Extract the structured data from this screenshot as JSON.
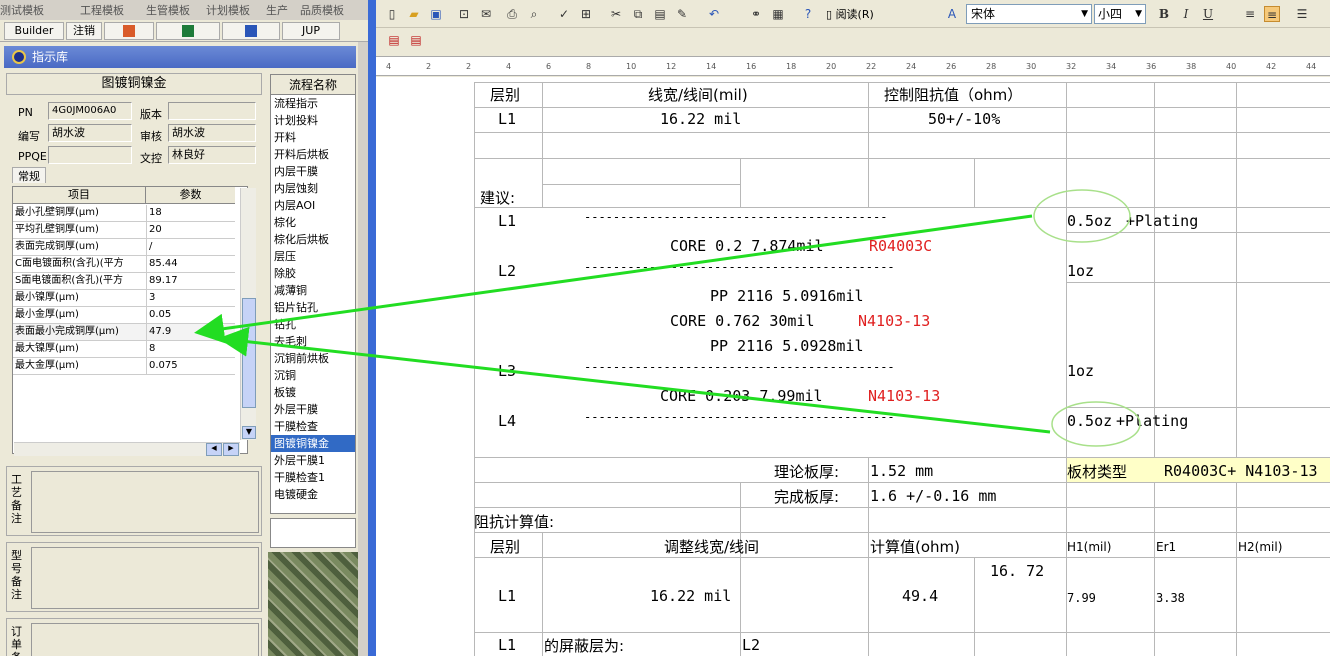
{
  "left": {
    "top_tabs": [
      "测试模板",
      "工程模板",
      "生管模板",
      "计划模板",
      "生产",
      "品质模板"
    ],
    "toolbar": {
      "builder": "Builder",
      "cancel": "注销",
      "jup": "JUP"
    },
    "panel_title": "指示库",
    "form_title": "图镀铜镍金",
    "fields": {
      "pn_label": "PN",
      "pn_value": "4G0JM006A0",
      "version_label": "版本",
      "version_value": "",
      "writer_label": "编写",
      "writer_value": "胡水波",
      "reviewer_label": "审核",
      "reviewer_value": "胡水波",
      "ppqe_label": "PPQE",
      "ppqe_value": "",
      "doc_label": "文控",
      "doc_value": "林良好"
    },
    "tab": "常规",
    "grid_headers": [
      "项目",
      "参数"
    ],
    "grid_rows": [
      {
        "item": "最小孔壁铜厚(μm)",
        "value": "18"
      },
      {
        "item": "平均孔壁铜厚(um)",
        "value": "20"
      },
      {
        "item": "表面完成铜厚(um)",
        "value": "/"
      },
      {
        "item": "C面电镀面积(含孔)(平方",
        "value": "85.44"
      },
      {
        "item": "S面电镀面积(含孔)(平方",
        "value": "89.17"
      },
      {
        "item": "最小镍厚(μm)",
        "value": "3"
      },
      {
        "item": "最小金厚(μm)",
        "value": "0.05"
      },
      {
        "item": "表面最小完成铜厚(μm)",
        "value": "47.9"
      },
      {
        "item": "最大镍厚(μm)",
        "value": "8"
      },
      {
        "item": "最大金厚(μm)",
        "value": "0.075"
      }
    ],
    "remarks": [
      "工艺备注",
      "型号备注",
      "订单备注"
    ],
    "process_header": "流程名称",
    "process_items": [
      "流程指示",
      "计划投料",
      "开料",
      "开料后烘板",
      "内层干膜",
      "内层蚀刻",
      "内层AOI",
      "棕化",
      "棕化后烘板",
      "层压",
      "除胶",
      "减薄铜",
      "铝片钻孔",
      "钻孔",
      "去毛刺",
      "沉铜前烘板",
      "沉铜",
      "板镀",
      "外层干膜",
      "干膜检查",
      "图镀铜镍金",
      "外层干膜1",
      "干膜检查1",
      "电镀硬金"
    ],
    "process_selected": 20
  },
  "word": {
    "read_btn": "阅读(R)",
    "font_name": "宋体",
    "font_size": "小四",
    "ruler_ticks": [
      "4",
      "2",
      "2",
      "4",
      "6",
      "8",
      "10",
      "12",
      "14",
      "16",
      "18",
      "20",
      "22",
      "24",
      "26",
      "28",
      "30",
      "32",
      "34",
      "36",
      "38",
      "40",
      "42",
      "44"
    ]
  },
  "doc": {
    "h_layer": "层别",
    "h_width": "线宽/线间(mil)",
    "h_imp": "控制阻抗值（ohm）",
    "r1_layer": "L1",
    "r1_width": "16.22 mil",
    "r1_imp": "50+/-10%",
    "suggest": "建议:",
    "stack_l1": "L1",
    "stack_l1_line": "------------------------------------------",
    "stack_l1_cu": "0.5oz",
    "stack_l1_plating": "+Plating",
    "core1": "CORE  0.2  7.874mil",
    "core1_code": "R04003C",
    "stack_l2": "L2",
    "stack_l2_line": "-------------------------------------------",
    "stack_l2_cu": "1oz",
    "pp1": "PP  2116  5.0916mil",
    "core2": "CORE  0.762  30mil",
    "core2_code": "N4103-13",
    "pp2": "PP  2116  5.0928mil",
    "stack_l3": "L3",
    "stack_l3_line": "-------------------------------------------",
    "stack_l3_cu": "1oz",
    "core3": "CORE  0.203  7.99mil",
    "core3_code": "N4103-13",
    "stack_l4": "L4",
    "stack_l4_line": "-------------------------------------------",
    "stack_l4_cu": "0.5oz",
    "stack_l4_plating": "+Plating",
    "theory_label": "理论板厚:",
    "theory_value": "1.52 mm",
    "material_label": "板材类型",
    "material_value": "R04003C+ N4103-13",
    "finish_label": "完成板厚:",
    "finish_value": "1.6 +/-0.16 mm",
    "calc_title": "阻抗计算值:",
    "c_layer": "层别",
    "c_width": "调整线宽/线间",
    "c_calc": "计算值(ohm)",
    "c_h1": "H1(mil)",
    "c_er1": "Er1",
    "c_h2": "H2(mil)",
    "c_extra": "16. 72",
    "cr_layer": "L1",
    "cr_width": "16.22 mil",
    "cr_calc": "49.4",
    "cr_h1": "7.99",
    "cr_er1": "3.38",
    "shield_layer": "L1",
    "shield_label": "的屏蔽层为:",
    "shield_value": "L2"
  }
}
